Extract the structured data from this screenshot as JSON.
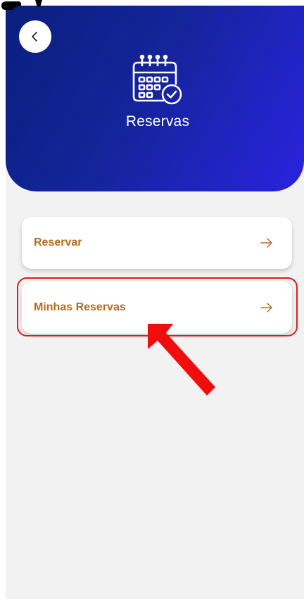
{
  "header": {
    "title": "Reservas",
    "back_icon": "chevron-left-icon",
    "calendar_icon": "calendar-check-icon",
    "gradient_colors": [
      "#0a1f7e",
      "#2a23df"
    ]
  },
  "menu": {
    "items": [
      {
        "label": "Reservar",
        "arrow_icon": "arrow-right-icon"
      },
      {
        "label": "Minhas Reservas",
        "arrow_icon": "arrow-right-icon",
        "highlighted": true
      }
    ],
    "label_color": "#b86a1a"
  },
  "annotation": {
    "arrow_color": "#f20d0d",
    "highlight_color": "#e01b1b"
  }
}
